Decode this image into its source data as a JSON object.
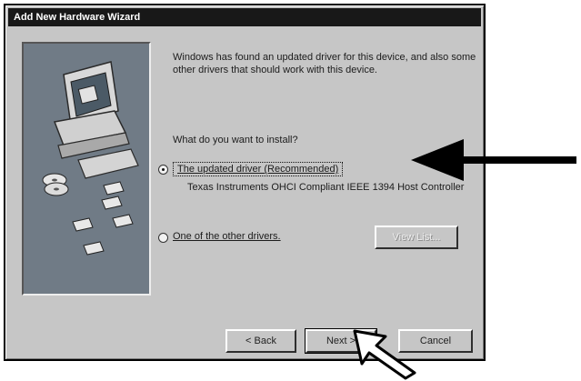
{
  "window": {
    "title": "Add New Hardware Wizard"
  },
  "content": {
    "intro": "Windows has found an updated driver for this device, and also some other drivers that should work with this device.",
    "question": "What do you want to install?",
    "option_updated": {
      "label": "The updated driver (Recommended)",
      "description": "Texas Instruments OHCI Compliant IEEE 1394 Host Controller",
      "selected": true
    },
    "option_other": {
      "label": "One of the other drivers.",
      "selected": false
    },
    "view_list_button": "View List..."
  },
  "footer": {
    "back_label": "< Back",
    "next_label": "Next >",
    "cancel_label": "Cancel"
  },
  "colors": {
    "dialog_face": "#c6c6c6",
    "titlebar": "#181818",
    "art_background": "#707b86",
    "annotation": "#000000"
  }
}
